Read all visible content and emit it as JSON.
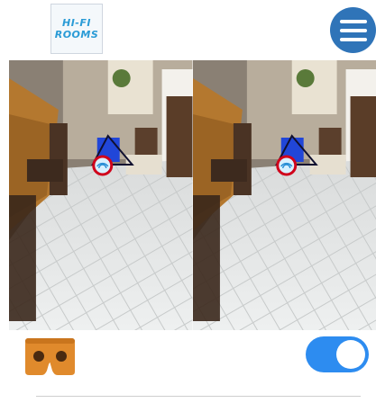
{
  "header": {
    "logo_line1": "HI-FI",
    "logo_line2": "ROOMS",
    "menu_icon": "hamburger-menu-icon"
  },
  "viewer": {
    "mode": "stereo",
    "marker_icon": "wifi-hotspot-icon"
  },
  "footer": {
    "cardboard_icon": "cardboard-vr-icon",
    "vr_toggle_on": true
  },
  "colors": {
    "menu_button": "#2f74b8",
    "toggle_on": "#2d8cf0",
    "cardboard": "#e08a2c",
    "marker_ring": "#d0021b",
    "marker_triangle": "#1f4fd6"
  }
}
